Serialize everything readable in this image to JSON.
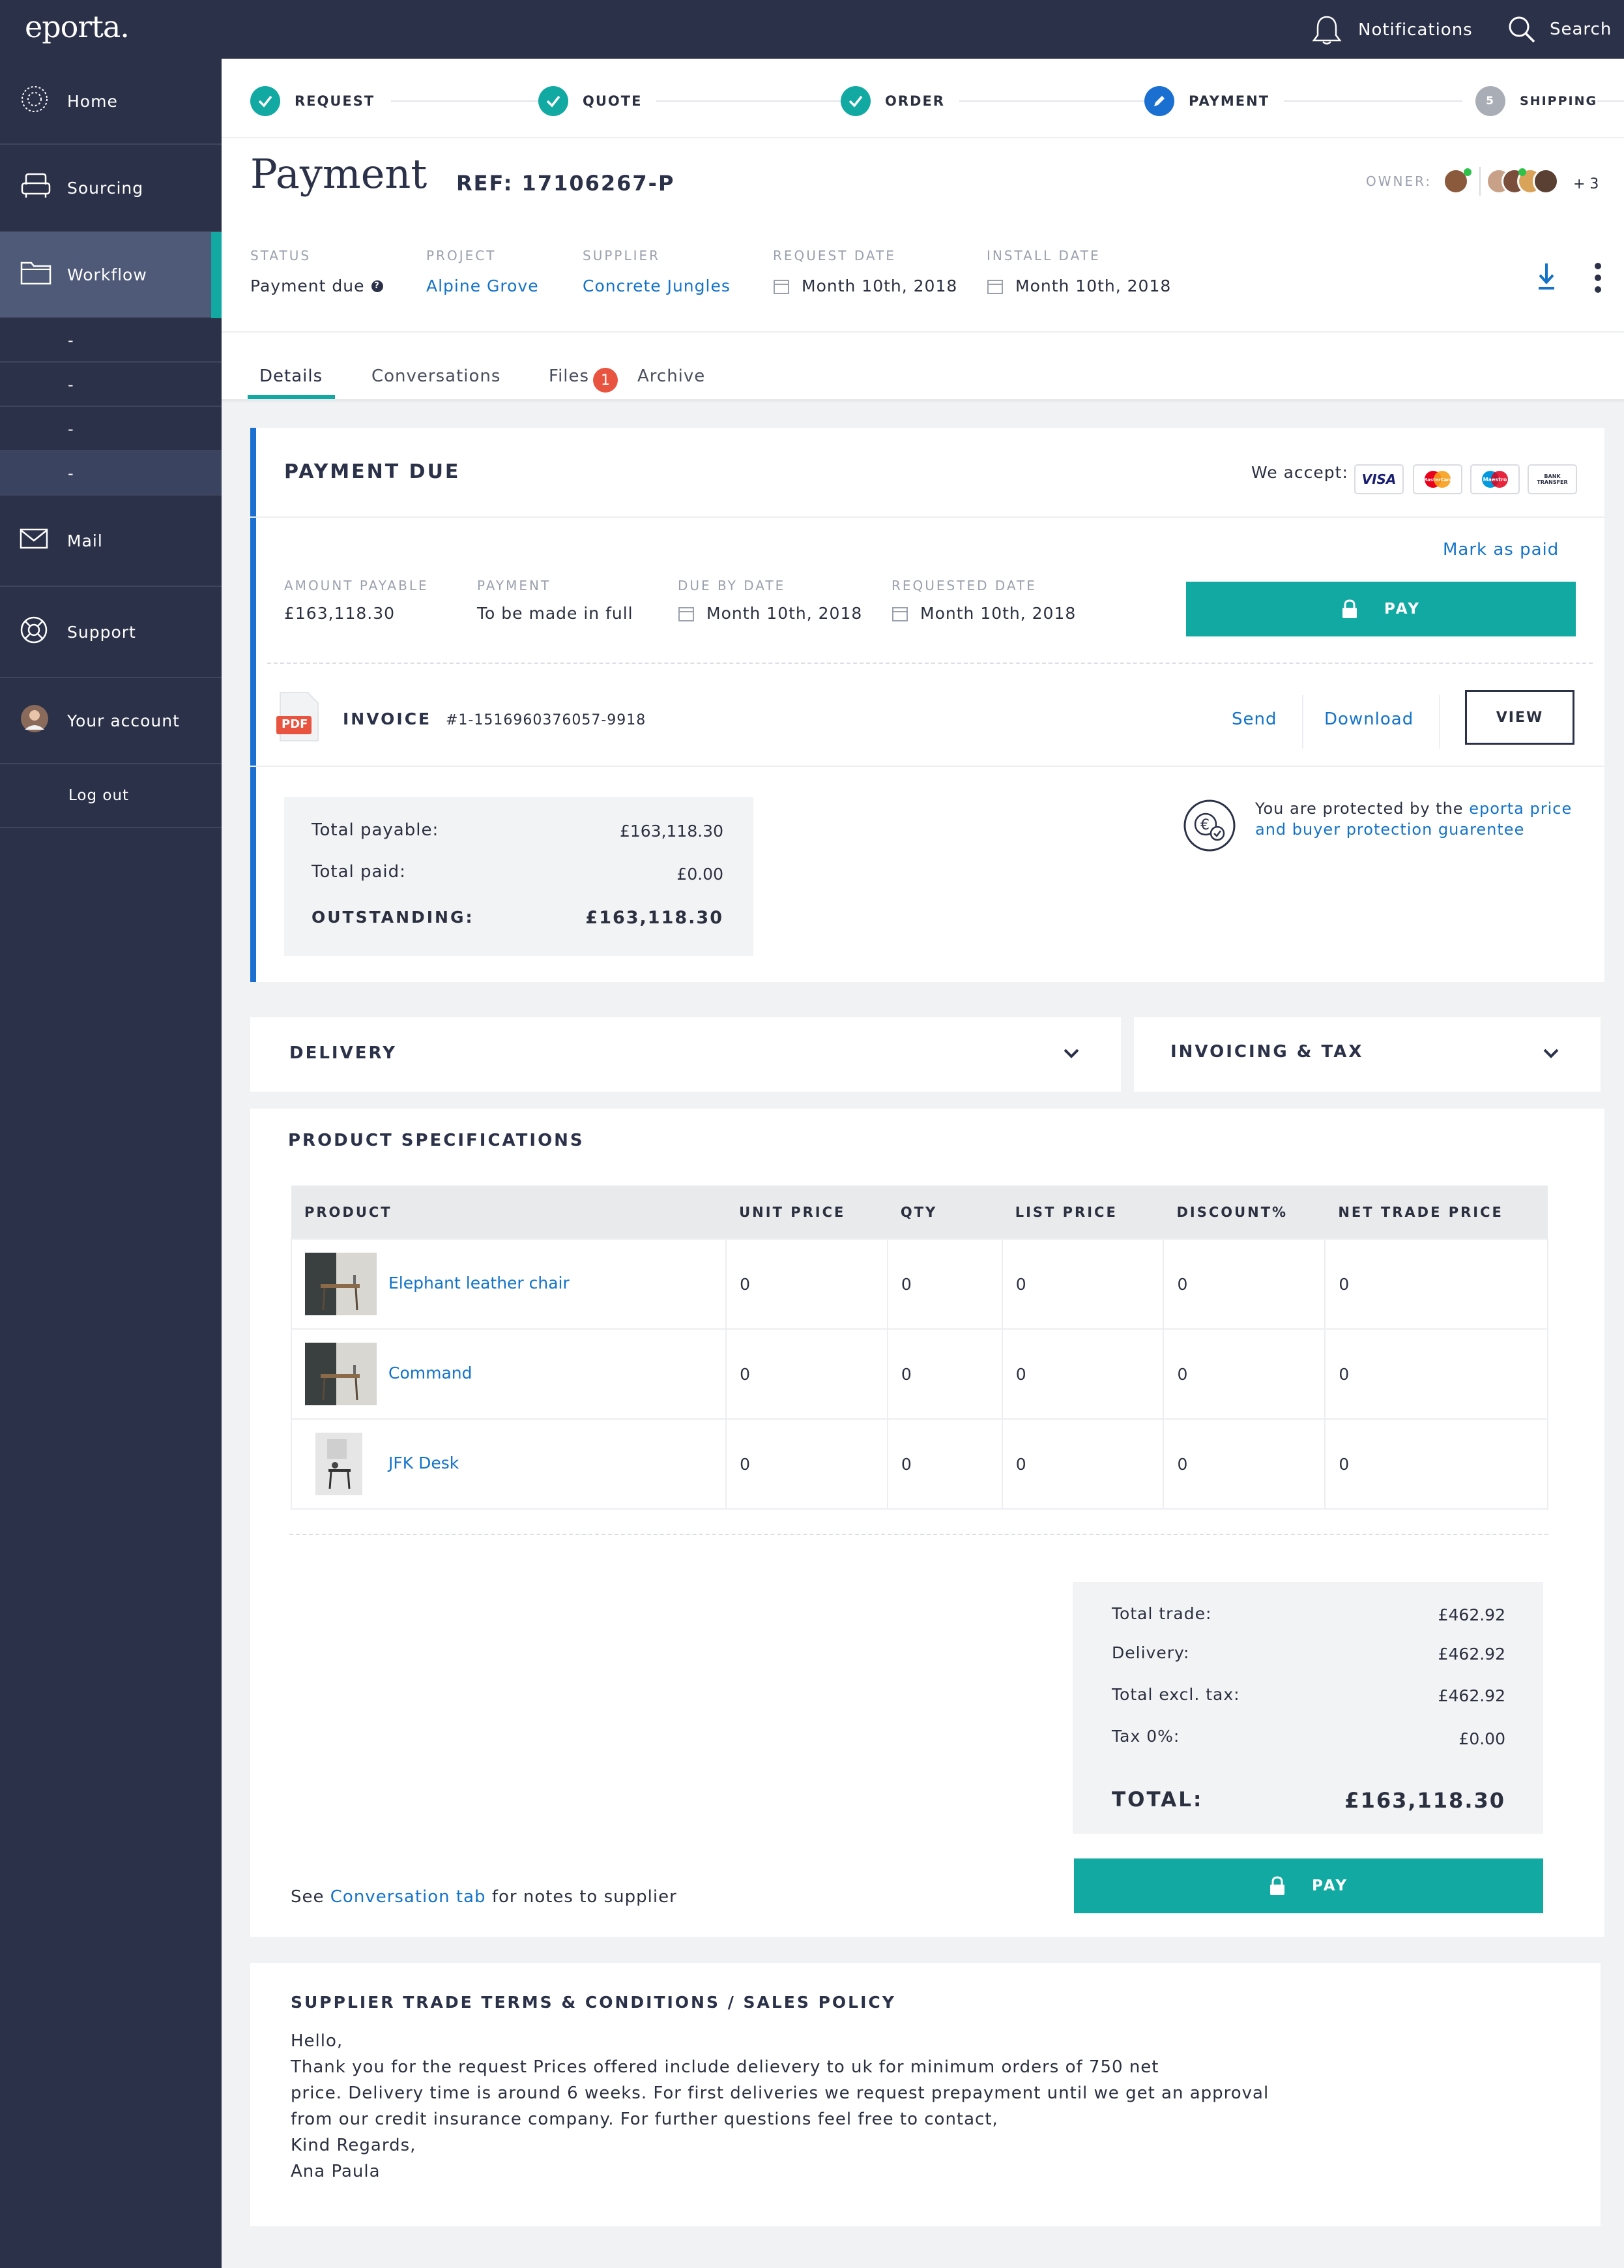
{
  "app": {
    "logo": "eporta.",
    "notifications": "Notifications",
    "search": "Search"
  },
  "sidebar": {
    "items": [
      {
        "label": "Home"
      },
      {
        "label": "Sourcing"
      },
      {
        "label": "Workflow"
      },
      {
        "label": "Mail"
      },
      {
        "label": "Support"
      },
      {
        "label": "Your account"
      },
      {
        "label": "Log out"
      }
    ],
    "subitems": [
      "-",
      "-",
      "-",
      "-"
    ]
  },
  "steps": [
    {
      "label": "REQUEST"
    },
    {
      "label": "QUOTE"
    },
    {
      "label": "ORDER"
    },
    {
      "label": "PAYMENT"
    },
    {
      "label": "SHIPPING",
      "num": "5"
    }
  ],
  "page": {
    "title": "Payment",
    "ref": "REF: 17106267-P",
    "owner_label": "OWNER:",
    "owner_more": "+ 3"
  },
  "meta": {
    "status_label": "STATUS",
    "status": "Payment due",
    "project_label": "PROJECT",
    "project": "Alpine Grove",
    "supplier_label": "SUPPLIER",
    "supplier": "Concrete Jungles",
    "request_date_label": "REQUEST DATE",
    "request_date": "Month 10th, 2018",
    "install_date_label": "INSTALL DATE",
    "install_date": "Month 10th, 2018"
  },
  "tabs": {
    "details": "Details",
    "conversations": "Conversations",
    "files": "Files",
    "files_count": "1",
    "archive": "Archive"
  },
  "payment": {
    "title": "PAYMENT DUE",
    "we_accept": "We accept:",
    "cards": [
      "VISA",
      "MasterCard",
      "Maestro",
      "BANK TRANSFER"
    ],
    "mark_paid": "Mark as paid",
    "amount_label": "AMOUNT PAYABLE",
    "amount": "£163,118.30",
    "payment_label": "PAYMENT",
    "payment": "To be made in full",
    "due_label": "DUE BY DATE",
    "due": "Month 10th, 2018",
    "requested_label": "REQUESTED DATE",
    "requested": "Month 10th, 2018",
    "pay": "PAY"
  },
  "invoice": {
    "pdf": "PDF",
    "label": "INVOICE",
    "number": "#1-1516960376057-9918",
    "send": "Send",
    "download": "Download",
    "view": "VIEW"
  },
  "totals": {
    "payable_label": "Total payable:",
    "payable": "£163,118.30",
    "paid_label": "Total paid:",
    "paid": "£0.00",
    "outstanding_label": "OUTSTANDING:",
    "outstanding": "£163,118.30"
  },
  "protection": {
    "text": "You are protected by the ",
    "link1": "eporta price",
    "link2": "and buyer protection guarentee"
  },
  "sections": {
    "delivery": "DELIVERY",
    "invoicing": "INVOICING & TAX",
    "specs": "PRODUCT SPECIFICATIONS"
  },
  "table": {
    "headers": [
      "PRODUCT",
      "UNIT PRICE",
      "QTY",
      "LIST PRICE",
      "DISCOUNT%",
      "NET TRADE PRICE"
    ],
    "rows": [
      {
        "name": "Elephant leather chair",
        "unit": "0",
        "qty": "0",
        "list": "0",
        "discount": "0",
        "net": "0"
      },
      {
        "name": "Command",
        "unit": "0",
        "qty": "0",
        "list": "0",
        "discount": "0",
        "net": "0"
      },
      {
        "name": "JFK Desk",
        "unit": "0",
        "qty": "0",
        "list": "0",
        "discount": "0",
        "net": "0"
      }
    ]
  },
  "summary": {
    "trade_label": "Total trade:",
    "trade": "£462.92",
    "delivery_label": "Delivery:",
    "delivery": "£462.92",
    "excl_label": "Total excl. tax:",
    "excl": "£462.92",
    "tax_label": "Tax 0%:",
    "tax": "£0.00",
    "total_label": "TOTAL:",
    "total": "£163,118.30",
    "pay": "PAY"
  },
  "note": {
    "pre": "See ",
    "link": "Conversation tab",
    "post": " for notes to supplier"
  },
  "terms": {
    "title": "SUPPLIER TRADE TERMS & CONDITIONS / SALES POLICY",
    "lines": [
      "Hello,",
      "Thank you for the request Prices offered include delievery to uk for minimum orders of 750 net",
      "price. Delivery time is around 6 weeks. For first deliveries we request prepayment until we get an approval",
      "from our credit insurance company. For further questions feel free to contact,",
      "Kind Regards,",
      "Ana Paula"
    ]
  },
  "colors": {
    "navy": "#2b3148",
    "teal": "#11a9a2",
    "blue": "#1373c9",
    "accent_bar": "#1a6fd0",
    "badge": "#e8543f"
  }
}
